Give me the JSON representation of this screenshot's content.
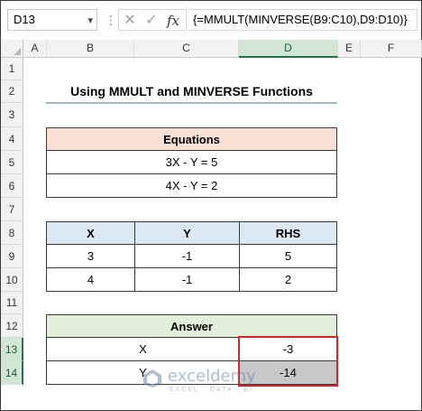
{
  "formula_bar": {
    "name_box": "D13",
    "fx_label": "fx",
    "formula": "{=MMULT(MINVERSE(B9:C10),D9:D10)}"
  },
  "columns": [
    "A",
    "B",
    "C",
    "D",
    "E",
    "F"
  ],
  "selected_column": "D",
  "rows": [
    "1",
    "2",
    "3",
    "4",
    "5",
    "6",
    "7",
    "8",
    "9",
    "10",
    "11",
    "12",
    "13",
    "14"
  ],
  "selected_rows": [
    "13",
    "14"
  ],
  "title": "Using MMULT and MINVERSE Functions",
  "equations": {
    "header": "Equations",
    "items": [
      "3X - Y = 5",
      "4X - Y = 2"
    ]
  },
  "coef_table": {
    "headers": [
      "X",
      "Y",
      "RHS"
    ],
    "rows": [
      [
        "3",
        "-1",
        "5"
      ],
      [
        "4",
        "-1",
        "2"
      ]
    ]
  },
  "answer": {
    "header": "Answer",
    "rows": [
      {
        "label": "X",
        "value": "-3"
      },
      {
        "label": "Y",
        "value": "-14"
      }
    ]
  },
  "watermark": {
    "brand": "exceldemy",
    "tagline": "EXCEL · DATA · BI"
  },
  "colors": {
    "eq_header_bg": "#fbe0d5",
    "table_header_bg": "#dce9f5",
    "answer_header_bg": "#e2efda",
    "highlight_border": "#d0262c",
    "selection_green": "#217346"
  }
}
